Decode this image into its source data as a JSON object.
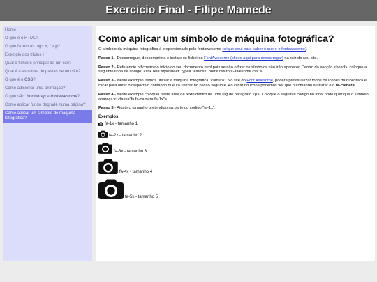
{
  "header": {
    "title": "Exercicio Final - Filipe Mamede"
  },
  "sidebar": {
    "items": [
      {
        "label": "Home"
      },
      {
        "label": "O que é o HTML?"
      },
      {
        "label": "O que fazem as tags b, i e p?"
      },
      {
        "label": "Exemplo dos títulos H"
      },
      {
        "label": "Qual o ficheiro principal de um site?"
      },
      {
        "label": "Qual é a estrutura de pastas de um site?"
      },
      {
        "label": "O que é o CSS?"
      },
      {
        "label": "Como adicionar uma animação?"
      },
      {
        "label": "O que são: bootstrap e fontawesome?"
      },
      {
        "label": "Como aplicar fundo degradê numa página?"
      },
      {
        "label": "Como aplicar um símbolo de máquina fotográfica?"
      }
    ]
  },
  "main": {
    "title": "Como aplicar um símbolo de máquina fotográfica?",
    "intro_text": "O símbolo da máquina fotográfica é proporcionado pelo fontawesome",
    "intro_link": "(clique aqui para saber o que é o fontawesome)",
    "step1_label": "Passo 1",
    "step1_text_a": " - Descarregue, descomprima e instale os ficheiros ",
    "step1_link": "FontAwesome (clique aqui para descarregar)",
    "step1_text_b": " na raiz do seu site.",
    "step2_label": "Passo 2",
    "step2_text": " - Referencie o ficheiro no início do seu documento html pois se não o fizer os símbolos não irão aparecer. Dentro da secção <head>, coloque a seguinte linha de código: <link rel=\"stylesheet\" type=\"text/css\" href=\"css/font-awesome.css\">.",
    "step3_label": "Passo 3",
    "step3_text_a": " - Neste exemplo iremos utilizar a máquina fotográfica \"camera\". No site do ",
    "step3_link": "Font Awesome",
    "step3_text_b": ", poderá prévisualizar todos os ícones da biblioteca e clicar para obter o respectivo comando que irá utilizar no passo seguinte. Ao clicar no ícone podemos ver que o comando a utilizar é o ",
    "step3_text_c": "fa-camera",
    "step4_label": "Passo 4",
    "step4_text": " - Neste exemplo coloquei nesta área de texto dentro de uma tag de parágrafo <p>. Coloque o seguinte código no local onde quer que o símbolo apareça:<i class=\"fa fa-camera fa-1x\">.",
    "step5_label": "Passo 5",
    "step5_text": " - Ajuste o tamanho pretendido na parte do código \"fa-1x\".",
    "examples_title": "Exemplos:",
    "examples": [
      {
        "label": "fa-1x - tamanho 1"
      },
      {
        "label": "fa-2x - tamanho 2"
      },
      {
        "label": "fa-3x - tamanho 3"
      },
      {
        "label": "fa-4x - tamanho 4"
      },
      {
        "label": "fa-5x - tamanho 5"
      }
    ]
  }
}
